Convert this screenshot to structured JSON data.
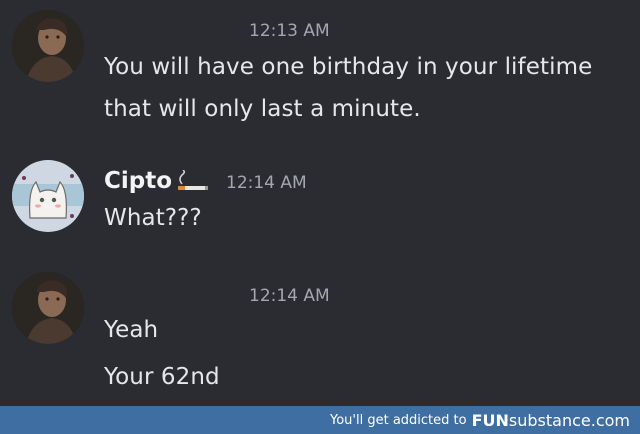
{
  "messages": [
    {
      "timestamp": "12:13 AM",
      "lines": [
        "You will have one birthday in your lifetime",
        "that will only last a minute."
      ]
    },
    {
      "author": "Cipto",
      "author_badge_icon": "cigarette-icon",
      "timestamp": "12:14 AM",
      "lines": [
        "What???"
      ]
    },
    {
      "timestamp": "12:14 AM",
      "lines": [
        "Yeah",
        "Your 62nd"
      ]
    }
  ],
  "watermark": {
    "tagline": "You'll get addicted to",
    "brand_bold": "FUN",
    "brand_rest": "substance.com"
  },
  "colors": {
    "background": "#2b2c31",
    "text": "#e6e7ea",
    "timestamp": "#a4a7ad",
    "footer": "#3f6fa2"
  }
}
